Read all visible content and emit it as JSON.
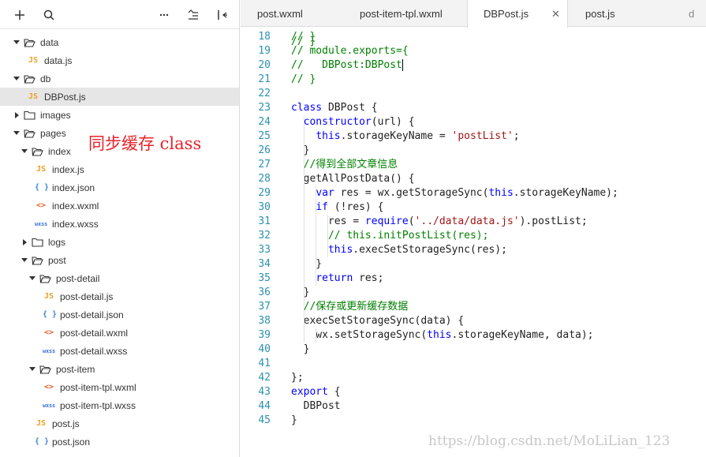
{
  "sidebar": {
    "toolbar": {
      "add_icon": "plus-icon",
      "search_icon": "search-icon",
      "more_icon": "ellipsis-icon",
      "collapse_icon": "collapse-tree-icon",
      "layout_icon": "split-layout-icon"
    },
    "tree": [
      {
        "label": "data",
        "kind": "folder",
        "expanded": true,
        "depth": 0
      },
      {
        "label": "data.js",
        "kind": "js",
        "depth": 1
      },
      {
        "label": "db",
        "kind": "folder",
        "expanded": true,
        "depth": 0
      },
      {
        "label": "DBPost.js",
        "kind": "js",
        "depth": 1,
        "selected": true
      },
      {
        "label": "images",
        "kind": "folder",
        "expanded": false,
        "depth": 0
      },
      {
        "label": "pages",
        "kind": "folder",
        "expanded": true,
        "depth": 0
      },
      {
        "label": "index",
        "kind": "folder",
        "expanded": true,
        "depth": 1
      },
      {
        "label": "index.js",
        "kind": "js",
        "depth": 2
      },
      {
        "label": "index.json",
        "kind": "json",
        "depth": 2
      },
      {
        "label": "index.wxml",
        "kind": "wxml",
        "depth": 2
      },
      {
        "label": "index.wxss",
        "kind": "wxss",
        "depth": 2
      },
      {
        "label": "logs",
        "kind": "folder",
        "expanded": false,
        "depth": 1
      },
      {
        "label": "post",
        "kind": "folder",
        "expanded": true,
        "depth": 1
      },
      {
        "label": "post-detail",
        "kind": "folder",
        "expanded": true,
        "depth": 2
      },
      {
        "label": "post-detail.js",
        "kind": "js",
        "depth": 3
      },
      {
        "label": "post-detail.json",
        "kind": "json",
        "depth": 3
      },
      {
        "label": "post-detail.wxml",
        "kind": "wxml",
        "depth": 3
      },
      {
        "label": "post-detail.wxss",
        "kind": "wxss",
        "depth": 3
      },
      {
        "label": "post-item",
        "kind": "folder",
        "expanded": true,
        "depth": 2
      },
      {
        "label": "post-item-tpl.wxml",
        "kind": "wxml",
        "depth": 3
      },
      {
        "label": "post-item-tpl.wxss",
        "kind": "wxss",
        "depth": 3
      },
      {
        "label": "post.js",
        "kind": "js",
        "depth": 2
      },
      {
        "label": "post.json",
        "kind": "json",
        "depth": 2
      }
    ],
    "file_icon_text": {
      "js": "JS",
      "json": "{ }",
      "wxml": "<>",
      "wxss": "wxss"
    }
  },
  "annotation": "同步缓存 class",
  "tabs": [
    {
      "label": "post.wxml",
      "active": false
    },
    {
      "label": "post-item-tpl.wxml",
      "active": false
    },
    {
      "label": "DBPost.js",
      "active": true
    },
    {
      "label": "post.js",
      "active": false
    },
    {
      "label": "d",
      "active": false
    }
  ],
  "tab_close_symbol": "✕",
  "editor": {
    "lines": [
      {
        "n": "18",
        "t": [
          [
            "cm",
            "// }"
          ]
        ]
      },
      {
        "n": "19",
        "t": [
          [
            "cm",
            "// module.exports={"
          ]
        ]
      },
      {
        "n": "20",
        "t": [
          [
            "cm",
            "//   DBPost:DBPost"
          ]
        ],
        "cursor": true
      },
      {
        "n": "21",
        "t": [
          [
            "cm",
            "// }"
          ]
        ]
      },
      {
        "n": "22",
        "t": []
      },
      {
        "n": "23",
        "t": [
          [
            "kw",
            "class"
          ],
          [
            "",
            " DBPost {"
          ]
        ]
      },
      {
        "n": "24",
        "t": [
          [
            "",
            "  "
          ],
          [
            "kw",
            "constructor"
          ],
          [
            "",
            "(url) {"
          ]
        ]
      },
      {
        "n": "25",
        "t": [
          [
            "",
            "    "
          ],
          [
            "kw",
            "this"
          ],
          [
            "",
            ".storageKeyName = "
          ],
          [
            "st",
            "'postList'"
          ],
          [
            "",
            ";"
          ]
        ]
      },
      {
        "n": "26",
        "t": [
          [
            "",
            "  }"
          ]
        ]
      },
      {
        "n": "27",
        "t": [
          [
            "",
            "  "
          ],
          [
            "cm",
            "//得到全部文章信息"
          ]
        ]
      },
      {
        "n": "28",
        "t": [
          [
            "",
            "  getAllPostData() {"
          ]
        ]
      },
      {
        "n": "29",
        "t": [
          [
            "",
            "    "
          ],
          [
            "kw",
            "var"
          ],
          [
            "",
            " res = wx.getStorageSync("
          ],
          [
            "kw",
            "this"
          ],
          [
            "",
            ".storageKeyName);"
          ]
        ]
      },
      {
        "n": "30",
        "t": [
          [
            "",
            "    "
          ],
          [
            "kw",
            "if"
          ],
          [
            "",
            " (!res) {"
          ]
        ]
      },
      {
        "n": "31",
        "t": [
          [
            "",
            "      res = "
          ],
          [
            "kw",
            "require"
          ],
          [
            "",
            "("
          ],
          [
            "st",
            "'../data/data.js'"
          ],
          [
            "",
            ").postList;"
          ]
        ]
      },
      {
        "n": "32",
        "t": [
          [
            "",
            "      "
          ],
          [
            "cm",
            "// this.initPostList(res);"
          ]
        ]
      },
      {
        "n": "33",
        "t": [
          [
            "",
            "      "
          ],
          [
            "kw",
            "this"
          ],
          [
            "",
            ".execSetStorageSync(res);"
          ]
        ]
      },
      {
        "n": "34",
        "t": [
          [
            "",
            "    }"
          ]
        ]
      },
      {
        "n": "35",
        "t": [
          [
            "",
            "    "
          ],
          [
            "kw",
            "return"
          ],
          [
            "",
            " res;"
          ]
        ]
      },
      {
        "n": "36",
        "t": [
          [
            "",
            "  }"
          ]
        ]
      },
      {
        "n": "37",
        "t": [
          [
            "",
            "  "
          ],
          [
            "cm",
            "//保存或更新缓存数据"
          ]
        ]
      },
      {
        "n": "38",
        "t": [
          [
            "",
            "  execSetStorageSync(data) {"
          ]
        ]
      },
      {
        "n": "39",
        "t": [
          [
            "",
            "    wx.setStorageSync("
          ],
          [
            "kw",
            "this"
          ],
          [
            "",
            ".storageKeyName, data);"
          ]
        ]
      },
      {
        "n": "40",
        "t": [
          [
            "",
            "  }"
          ]
        ]
      },
      {
        "n": "41",
        "t": []
      },
      {
        "n": "42",
        "t": [
          [
            "",
            "};"
          ]
        ]
      },
      {
        "n": "43",
        "t": [
          [
            "kw",
            "export"
          ],
          [
            "",
            " {"
          ]
        ]
      },
      {
        "n": "44",
        "t": [
          [
            "",
            "  DBPost"
          ]
        ]
      },
      {
        "n": "45",
        "t": [
          [
            "",
            "}"
          ]
        ]
      }
    ]
  },
  "watermark": "https://blog.csdn.net/MoLiLian_123"
}
